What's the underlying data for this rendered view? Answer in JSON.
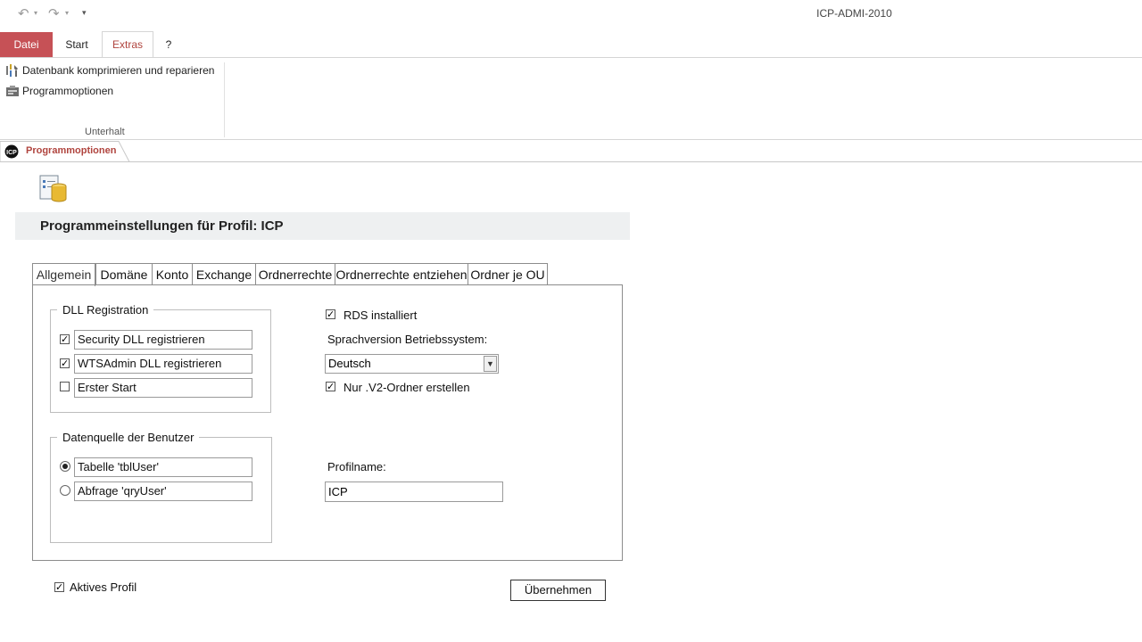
{
  "window": {
    "title": "ICP-ADMI-2010"
  },
  "qat": {
    "undo_icon": "undo-icon",
    "redo_icon": "redo-icon",
    "customize_icon": "customize-icon"
  },
  "ribbon": {
    "tabs": [
      {
        "label": "Datei"
      },
      {
        "label": "Start"
      },
      {
        "label": "Extras",
        "active": true
      },
      {
        "label": "?"
      }
    ],
    "commands": [
      {
        "label": "Datenbank komprimieren und reparieren",
        "icon": "compact-repair-icon"
      },
      {
        "label": "Programmoptionen",
        "icon": "options-icon"
      }
    ],
    "group_label": "Unterhalt"
  },
  "document_tab": {
    "label": "Programmoptionen",
    "logo_text": "ICP"
  },
  "form": {
    "title": "Programmeinstellungen für Profil: ICP",
    "header_icon": "settings-database-icon",
    "tabs": [
      "Allgemein",
      "Domäne",
      "Konto",
      "Exchange",
      "Ordnerrechte",
      "Ordnerrechte entziehen",
      "Ordner je OU"
    ],
    "dll_group": {
      "legend": "DLL Registration",
      "items": [
        {
          "label": "Security DLL registrieren",
          "checked": true
        },
        {
          "label": "WTSAdmin DLL registrieren",
          "checked": true
        },
        {
          "label": "Erster Start",
          "checked": false
        }
      ]
    },
    "source_group": {
      "legend": "Datenquelle der Benutzer",
      "options": [
        {
          "label": "Tabelle 'tblUser'",
          "selected": true
        },
        {
          "label": "Abfrage 'qryUser'",
          "selected": false
        }
      ]
    },
    "rds": {
      "label": "RDS installiert",
      "checked": true
    },
    "language": {
      "label": "Sprachversion Betriebssystem:",
      "value": "Deutsch"
    },
    "v2": {
      "label": "Nur .V2-Ordner erstellen",
      "checked": true
    },
    "profile": {
      "label": "Profilname:",
      "value": "ICP"
    },
    "active_profile": {
      "label": "Aktives Profil",
      "checked": true
    },
    "apply_label": "Übernehmen"
  },
  "colors": {
    "accent": "#b0443e",
    "file_tab": "#c65156",
    "header_band": "#eef0f1"
  }
}
